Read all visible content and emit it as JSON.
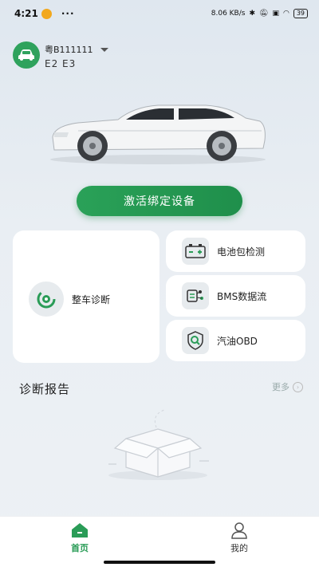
{
  "status_bar": {
    "time": "4:21",
    "dots": "···",
    "network": "8.06 KB/s",
    "battery": "39"
  },
  "vehicle": {
    "plate": "粤B111111",
    "sub": "E2 E3"
  },
  "activate_label": "激活绑定设备",
  "features": {
    "full_diagnosis": "整车诊断",
    "battery_check": "电池包检测",
    "bms_stream": "BMS数据流",
    "gasoline_obd": "汽油OBD"
  },
  "report": {
    "title": "诊断报告",
    "more": "更多"
  },
  "tabs": [
    {
      "label": "首页",
      "active": true
    },
    {
      "label": "我的",
      "active": false
    }
  ],
  "colors": {
    "accent": "#2aa158",
    "background": "#e6ecf2"
  }
}
